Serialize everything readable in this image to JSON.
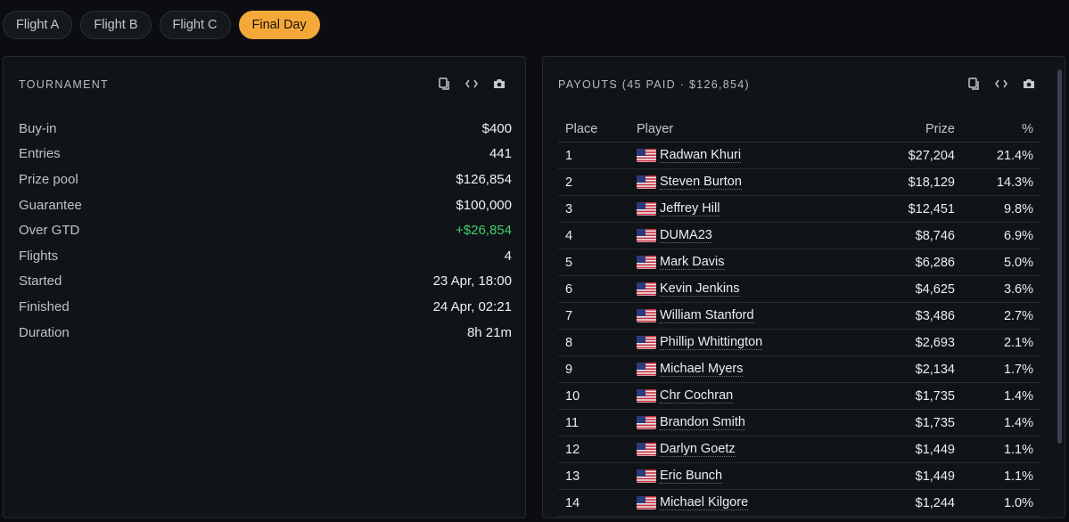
{
  "tabs": [
    {
      "label": "Flight A",
      "active": false
    },
    {
      "label": "Flight B",
      "active": false
    },
    {
      "label": "Flight C",
      "active": false
    },
    {
      "label": "Final Day",
      "active": true
    }
  ],
  "tournament": {
    "title": "TOURNAMENT",
    "stats": [
      {
        "label": "Buy-in",
        "value": "$400"
      },
      {
        "label": "Entries",
        "value": "441"
      },
      {
        "label": "Prize pool",
        "value": "$126,854"
      },
      {
        "label": "Guarantee",
        "value": "$100,000"
      },
      {
        "label": "Over GTD",
        "value": "+$26,854",
        "highlight": "green"
      },
      {
        "label": "Flights",
        "value": "4"
      },
      {
        "label": "Started",
        "value": "23 Apr, 18:00"
      },
      {
        "label": "Finished",
        "value": "24 Apr, 02:21"
      },
      {
        "label": "Duration",
        "value": "8h 21m"
      }
    ]
  },
  "payouts": {
    "title": "PAYOUTS (45 PAID · $126,854)",
    "columns": {
      "place": "Place",
      "player": "Player",
      "prize": "Prize",
      "pct": "%"
    },
    "rows": [
      {
        "place": "1",
        "player": "Radwan Khuri",
        "prize": "$27,204",
        "pct": "21.4%"
      },
      {
        "place": "2",
        "player": "Steven Burton",
        "prize": "$18,129",
        "pct": "14.3%"
      },
      {
        "place": "3",
        "player": "Jeffrey Hill",
        "prize": "$12,451",
        "pct": "9.8%"
      },
      {
        "place": "4",
        "player": "DUMA23",
        "prize": "$8,746",
        "pct": "6.9%"
      },
      {
        "place": "5",
        "player": "Mark Davis",
        "prize": "$6,286",
        "pct": "5.0%"
      },
      {
        "place": "6",
        "player": "Kevin Jenkins",
        "prize": "$4,625",
        "pct": "3.6%"
      },
      {
        "place": "7",
        "player": "William Stanford",
        "prize": "$3,486",
        "pct": "2.7%"
      },
      {
        "place": "8",
        "player": "Phillip Whittington",
        "prize": "$2,693",
        "pct": "2.1%"
      },
      {
        "place": "9",
        "player": "Michael Myers",
        "prize": "$2,134",
        "pct": "1.7%"
      },
      {
        "place": "10",
        "player": "Chr Cochran",
        "prize": "$1,735",
        "pct": "1.4%"
      },
      {
        "place": "11",
        "player": "Brandon Smith",
        "prize": "$1,735",
        "pct": "1.4%"
      },
      {
        "place": "12",
        "player": "Darlyn Goetz",
        "prize": "$1,449",
        "pct": "1.1%"
      },
      {
        "place": "13",
        "player": "Eric Bunch",
        "prize": "$1,449",
        "pct": "1.1%"
      },
      {
        "place": "14",
        "player": "Michael Kilgore",
        "prize": "$1,244",
        "pct": "1.0%"
      }
    ]
  },
  "icons": {
    "copy": "copy-icon",
    "embed": "code-icon",
    "screenshot": "camera-icon",
    "flag": "us-flag-icon"
  },
  "colors": {
    "accent": "#f5a83a",
    "positive": "#3fcf6e",
    "background": "#0b0d11",
    "panel": "#101317"
  }
}
